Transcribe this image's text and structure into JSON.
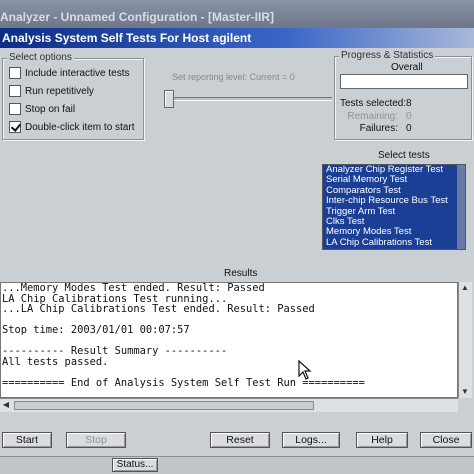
{
  "outer_window": {
    "title": "Analyzer - Unnamed Configuration - [Master-IIR]"
  },
  "window": {
    "title": "Analysis System Self Tests For Host agilent"
  },
  "select_options": {
    "legend": "Select options",
    "items": [
      {
        "label": "Include interactive tests",
        "checked": false
      },
      {
        "label": "Run repetitively",
        "checked": false
      },
      {
        "label": "Stop on fail",
        "checked": false
      },
      {
        "label": "Double-click item to start",
        "checked": true
      }
    ]
  },
  "reporting": {
    "label": "Set reporting level: Current = 0",
    "level": 0
  },
  "progress": {
    "legend": "Progress & Statistics",
    "overall_label": "Overall",
    "overall_fraction": 0,
    "tests_selected_label": "Tests selected:",
    "tests_selected": "8",
    "remaining_label": "Remaining:",
    "remaining": "0",
    "failures_label": "Failures:",
    "failures": "0"
  },
  "select_tests": {
    "label": "Select tests",
    "items": [
      "Analyzer Chip Register Test",
      "Serial Memory Test",
      "Comparators Test",
      "Inter-chip Resource Bus Test",
      "Trigger Arm Test",
      "Clks Test",
      "Memory Modes Test",
      "LA Chip Calibrations Test"
    ]
  },
  "results": {
    "label": "Results",
    "lines": [
      "...Memory Modes Test ended. Result: Passed",
      "LA Chip Calibrations Test running...",
      "...LA Chip Calibrations Test ended. Result: Passed",
      "",
      "Stop time: 2003/01/01 00:07:57",
      "",
      "---------- Result Summary ----------",
      "All tests passed.",
      "",
      "========== End of Analysis System Self Test Run =========="
    ]
  },
  "buttons": {
    "start": "Start",
    "stop": "Stop",
    "reset": "Reset",
    "logs": "Logs...",
    "help": "Help",
    "close": "Close"
  },
  "status": {
    "label": "Status..."
  }
}
